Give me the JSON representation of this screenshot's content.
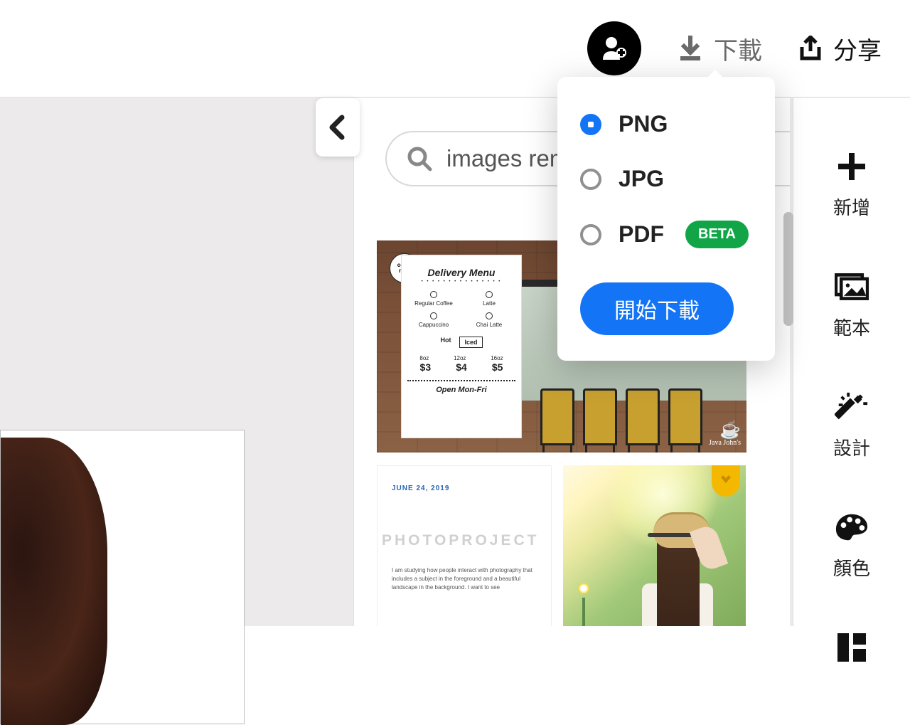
{
  "header": {
    "download_label": "下載",
    "share_label": "分享"
  },
  "search": {
    "value": "images rem"
  },
  "download_menu": {
    "options": [
      {
        "label": "PNG",
        "selected": true
      },
      {
        "label": "JPG",
        "selected": false
      },
      {
        "label": "PDF",
        "selected": false,
        "badge": "BETA"
      }
    ],
    "start_label": "開始下載"
  },
  "right_tools": [
    {
      "label": "新增",
      "icon": "plus"
    },
    {
      "label": "範本",
      "icon": "template"
    },
    {
      "label": "設計",
      "icon": "wand"
    },
    {
      "label": "顏色",
      "icon": "palette"
    },
    {
      "label": "",
      "icon": "layout"
    }
  ],
  "template1": {
    "order_badge_1": "order",
    "order_badge_2": "now",
    "title": "Delivery Menu",
    "items": [
      "Regular Coffee",
      "Latte",
      "Cappuccino",
      "Chai Latte"
    ],
    "hot": "Hot",
    "iced": "Iced",
    "sizes": [
      "8oz",
      "12oz",
      "16oz"
    ],
    "prices": [
      "$3",
      "$4",
      "$5"
    ],
    "hours": "Open Mon-Fri",
    "brand": "Java John's"
  },
  "template2": {
    "date": "JUNE 24, 2019",
    "title": "PHOTOPROJECT",
    "text": "I am studying how people interact with photography that includes a subject in the foreground and a beautiful landscape in the background. I want to see"
  }
}
